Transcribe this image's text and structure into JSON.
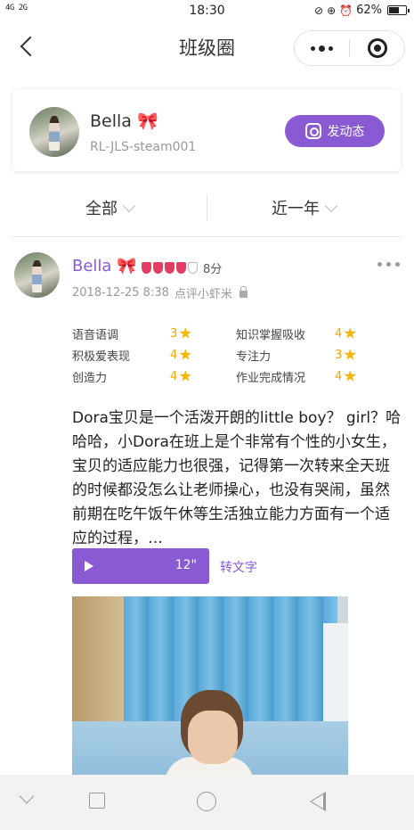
{
  "status_bar": {
    "network": "4G 2G",
    "time": "18:30",
    "battery": "62%",
    "battery_level": 0.62
  },
  "nav": {
    "title": "班级圈"
  },
  "profile": {
    "name": "Bella 🎀",
    "id": "RL-JLS-steam001",
    "post_button": "发动态"
  },
  "filters": {
    "scope": "全部",
    "period": "近一年"
  },
  "post": {
    "author": "Bella 🎀",
    "medals_filled": 4,
    "medals_total": 5,
    "score": "8分",
    "date": "2018-12-25 8:38",
    "reviewer": "点评小虾米",
    "scores": [
      {
        "label": "语音语调",
        "value": "3"
      },
      {
        "label": "知识掌握吸收",
        "value": "4"
      },
      {
        "label": "积极爱表现",
        "value": "4"
      },
      {
        "label": "专注力",
        "value": "3"
      },
      {
        "label": "创造力",
        "value": "4"
      },
      {
        "label": "作业完成情况",
        "value": "4"
      }
    ],
    "content": "Dora宝贝是一个活泼开朗的little boy？ girl？哈哈哈，小Dora在班上是个非常有个性的小女生，宝贝的适应能力也很强，记得第一次转来全天班的时候都没怎么让老师操心，也没有哭闹，虽然前期在吃午饭午休等生活独立能力方面有一个适应的过程，…",
    "voice_duration": "12\"",
    "to_text": "转文字"
  },
  "colors": {
    "accent": "#8a5ad4",
    "medal": "#e23d63",
    "star": "#f5b400"
  }
}
